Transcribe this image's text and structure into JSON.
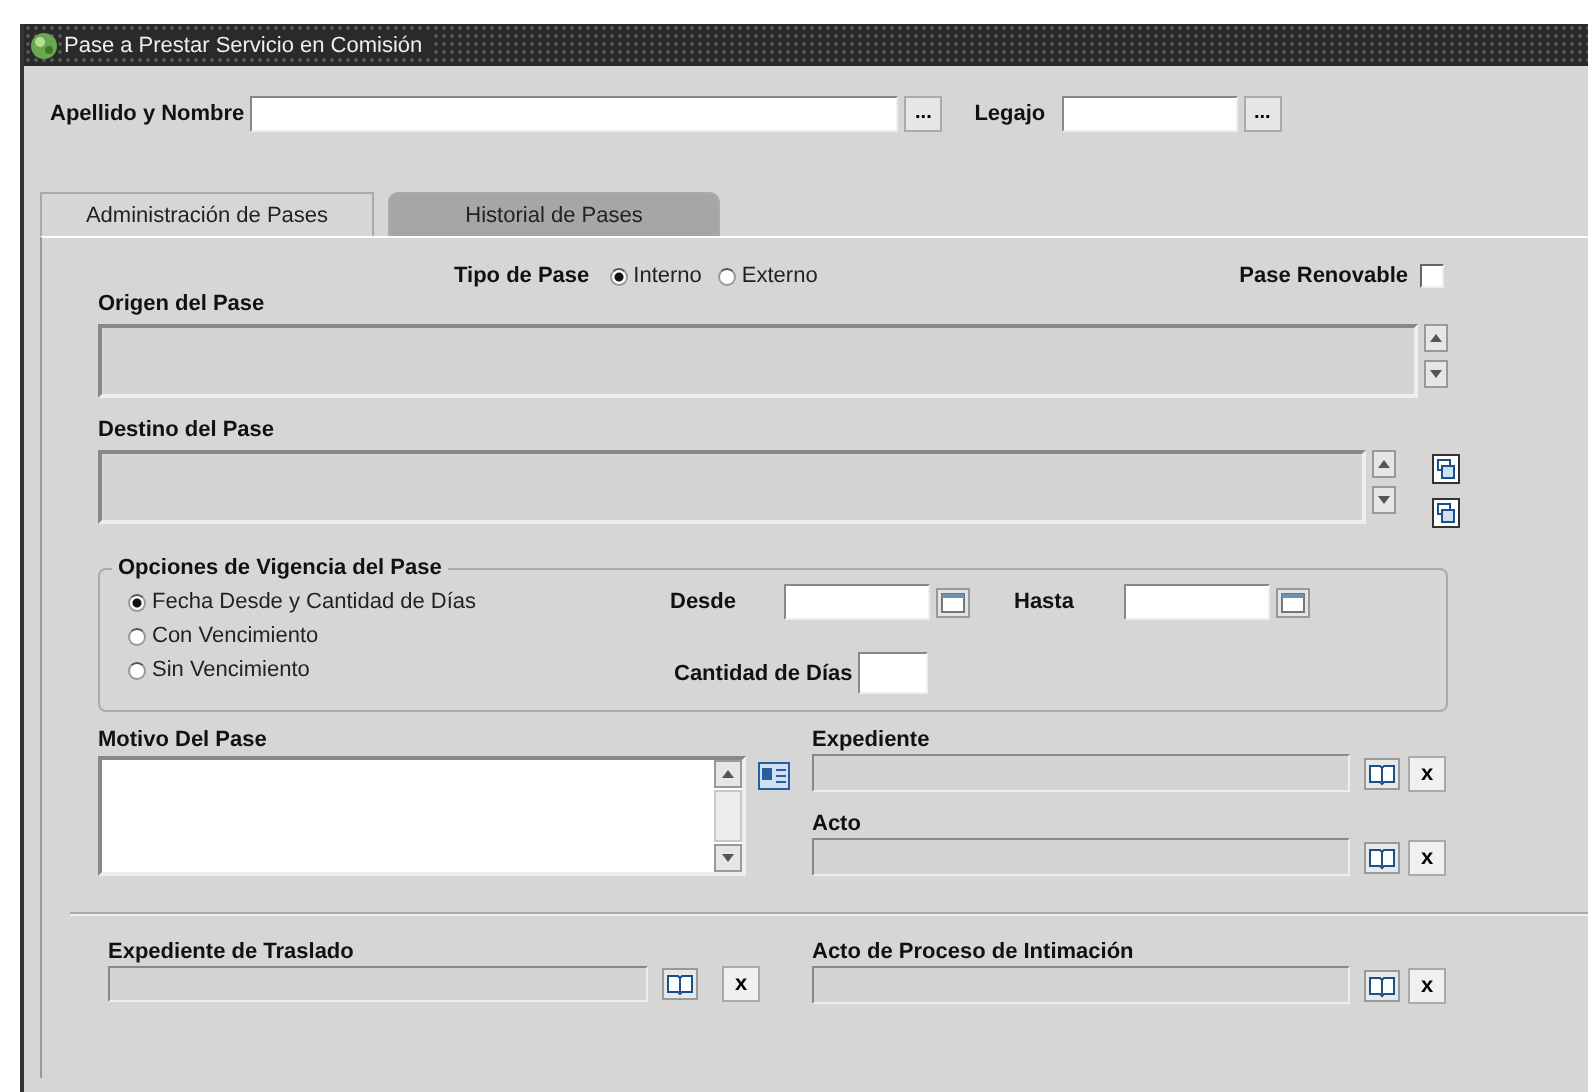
{
  "window": {
    "title": "Pase a Prestar Servicio en Comisión"
  },
  "search": [
    {
      "label": "Apellido y Nombre",
      "button": "..."
    },
    {
      "label": "Legajo",
      "button": "..."
    }
  ],
  "tabs": [
    {
      "label": "Administración de Pases",
      "selected": true
    },
    {
      "label": "Historial de Pases",
      "selected": false
    }
  ],
  "tipo_de_pase": {
    "label": "Tipo de Pase",
    "options": [
      {
        "label": "Interno",
        "selected": true
      },
      {
        "label": "Externo",
        "selected": false
      }
    ]
  },
  "pase_renovable": {
    "label": "Pase Renovable",
    "checked": false
  },
  "origen": {
    "label": "Origen del Pase"
  },
  "destino": {
    "label": "Destino del Pase"
  },
  "vigencia": {
    "title": "Opciones de Vigencia del Pase",
    "options": [
      {
        "label": "Fecha Desde y Cantidad de Días",
        "selected": true
      },
      {
        "label": "Con Vencimiento",
        "selected": false
      },
      {
        "label": "Sin Vencimiento",
        "selected": false
      }
    ],
    "desde": "Desde",
    "hasta": "Hasta",
    "cantidad": "Cantidad de Días"
  },
  "motivo": {
    "label": "Motivo Del Pase"
  },
  "expediente": {
    "label": "Expediente",
    "clear": "x"
  },
  "acto": {
    "label": "Acto",
    "clear": "x"
  },
  "traslado": {
    "label": "Expediente de Traslado",
    "clear": "x"
  },
  "intimacion": {
    "label": "Acto de Proceso de Intimación",
    "clear": "x"
  }
}
